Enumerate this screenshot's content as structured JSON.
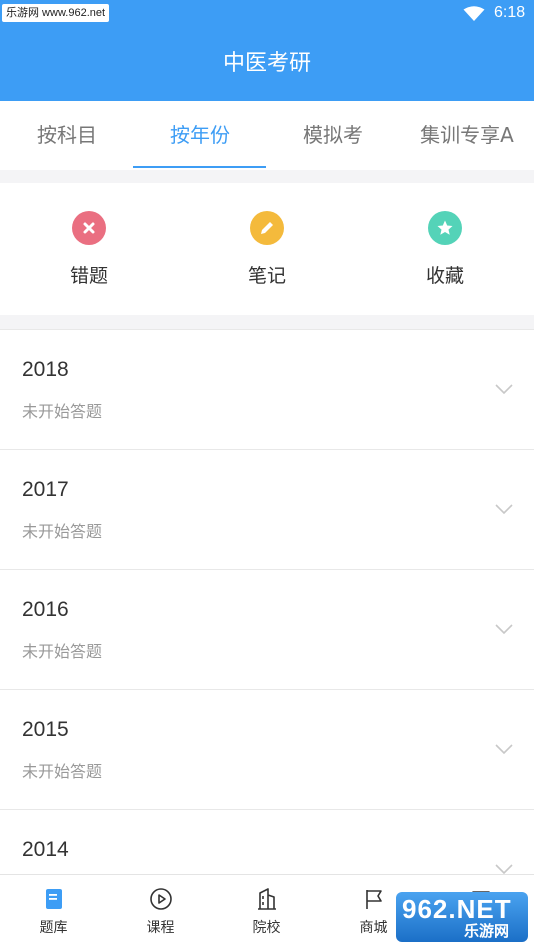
{
  "status_bar": {
    "watermark": "乐游网 www.962.net",
    "time": "6:18",
    "wifi_icon": "wifi-icon"
  },
  "app_bar": {
    "title": "中医考研"
  },
  "tabs": [
    {
      "label": "按科目",
      "active": false
    },
    {
      "label": "按年份",
      "active": true
    },
    {
      "label": "模拟考",
      "active": false
    },
    {
      "label": "集训专享A",
      "active": false
    }
  ],
  "quick_actions": [
    {
      "label": "错题",
      "icon": "x-circle-icon",
      "color": "#ea6f81"
    },
    {
      "label": "笔记",
      "icon": "pencil-icon",
      "color": "#f4ba3c"
    },
    {
      "label": "收藏",
      "icon": "star-icon",
      "color": "#54d3b8"
    }
  ],
  "years": [
    {
      "year": "2018",
      "status": "未开始答题"
    },
    {
      "year": "2017",
      "status": "未开始答题"
    },
    {
      "year": "2016",
      "status": "未开始答题"
    },
    {
      "year": "2015",
      "status": "未开始答题"
    },
    {
      "year": "2014",
      "status": ""
    }
  ],
  "bottom_nav": [
    {
      "label": "题库",
      "icon": "book-icon",
      "active": true
    },
    {
      "label": "课程",
      "icon": "play-circle-icon",
      "active": false
    },
    {
      "label": "院校",
      "icon": "building-icon",
      "active": false
    },
    {
      "label": "商城",
      "icon": "flag-icon",
      "active": false
    },
    {
      "label": "",
      "icon": "chat-icon",
      "active": false
    }
  ],
  "logo": {
    "main": "962.NET",
    "sub": "乐游网"
  },
  "colors": {
    "primary": "#3d9df5",
    "text": "#333333",
    "muted": "#999999"
  }
}
